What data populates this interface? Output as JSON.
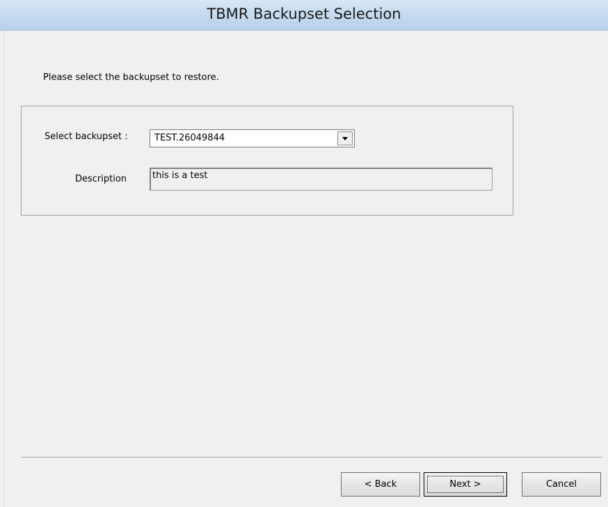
{
  "window": {
    "title": "TBMR Backupset Selection"
  },
  "page": {
    "instruction": "Please select the backupset to restore."
  },
  "form": {
    "backupset_label": "Select backupset :",
    "backupset_value": "TEST.26049844",
    "description_label": "Description",
    "description_value": "this is a test"
  },
  "buttons": {
    "back": "< Back",
    "next": "Next >",
    "cancel": "Cancel"
  },
  "colors": {
    "title_bar": "#c3d9ef",
    "background": "#f0f0f0"
  }
}
